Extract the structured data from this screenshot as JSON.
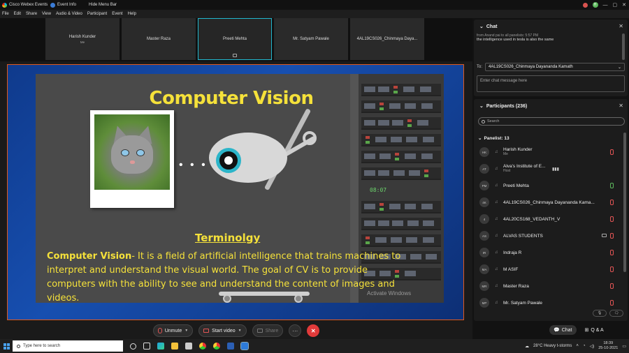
{
  "titlebar": {
    "app_name": "Cisco Webex Events",
    "event_info": "Event Info",
    "hide_menu": "Hide Menu Bar",
    "avatar_initials": "H"
  },
  "menu": [
    "File",
    "Edit",
    "Share",
    "View",
    "Audio & Video",
    "Participant",
    "Event",
    "Help"
  ],
  "video_tiles": [
    {
      "name": "Harish Kunder",
      "sub": "Me"
    },
    {
      "name": "Master Raza",
      "sub": ""
    },
    {
      "name": "Preeti Mehta",
      "sub": ""
    },
    {
      "name": "Mr. Satyam Pawale",
      "sub": ""
    },
    {
      "name": "4AL19CS026_Chinmaya Daya...",
      "sub": ""
    }
  ],
  "slide": {
    "title": "Computer Vision",
    "clock": "08:07",
    "terminology": "Terminolgy",
    "term": "Computer Vision",
    "body": "-  It is a field of artificial intelligence that trains machines to interpret and understand the visual world. The goal of CV is to provide computers with the ability to see and understand the content of images and videos.",
    "watermark": "Activate Windows"
  },
  "controls": {
    "unmute": "Unmute",
    "start_video": "Start video",
    "share": "Share",
    "more": "···",
    "leave": "✕"
  },
  "chat": {
    "title": "Chat",
    "msg_meta": "from Anand pai to all panelists:   5:57 PM",
    "msg_text": "the intelligence used in tesla is also the same",
    "to_label": "To:",
    "to_value": "4AL19CS026_Chinmaya Dayananda Kamath",
    "input_placeholder": "Enter chat message here"
  },
  "participants": {
    "title": "Participants (236)",
    "search_placeholder": "Search",
    "panelist_label": "Panelist: 13",
    "list": [
      {
        "initials": "HK",
        "name": "Harish Kunder",
        "role": "Me",
        "mic": "muted"
      },
      {
        "initials": "AT",
        "name": "Alva's Institute of E...",
        "role": "Host",
        "mic": "none"
      },
      {
        "initials": "PM",
        "name": "Preeti Mehta",
        "role": "",
        "mic": "on"
      },
      {
        "initials": "4K",
        "name": "4AL19CS026_Chinmaya Dayananda Kama...",
        "role": "",
        "mic": "muted"
      },
      {
        "initials": "4",
        "name": "4AL20CS168_VEDANTH_V",
        "role": "",
        "mic": "muted"
      },
      {
        "initials": "AS",
        "name": "ALVAS STUDENTS",
        "role": "",
        "mic": "muted"
      },
      {
        "initials": "IR",
        "name": "Indraja R",
        "role": "",
        "mic": "muted"
      },
      {
        "initials": "MA",
        "name": "M ASIF",
        "role": "",
        "mic": "muted"
      },
      {
        "initials": "MR",
        "name": "Master Raza",
        "role": "",
        "mic": "muted"
      },
      {
        "initials": "MP",
        "name": "Mr. Satyam Pawale",
        "role": "",
        "mic": "muted"
      }
    ]
  },
  "bottom_tabs": {
    "chat": "Chat",
    "qa": "Q & A"
  },
  "taskbar": {
    "search_placeholder": "Type here to search",
    "weather": "28°C  Heavy t-storms",
    "time": "18:39",
    "date": "25-10-2021"
  },
  "colors": {
    "accent": "#22b8cf",
    "slide_text": "#f5e13a",
    "leave": "#e13a3a"
  }
}
